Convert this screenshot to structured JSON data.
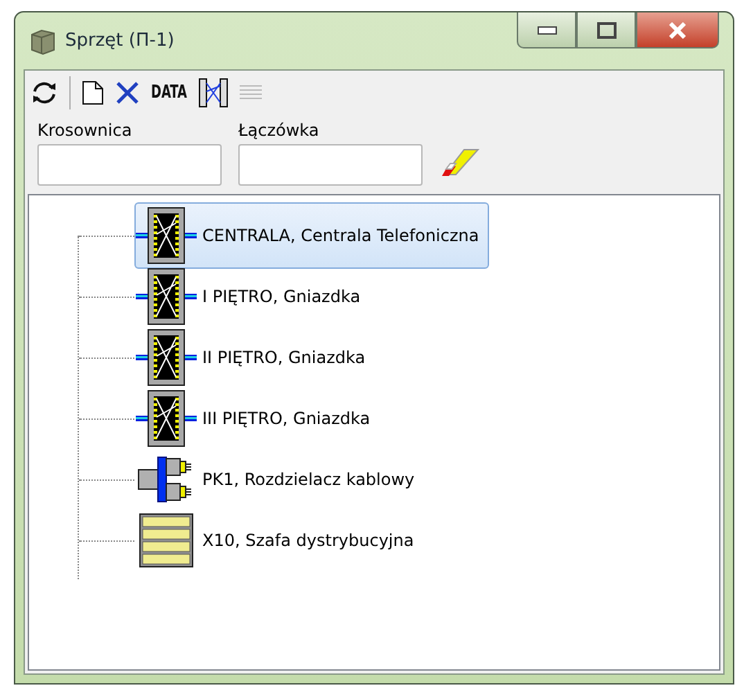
{
  "window": {
    "title": "Sprzęt (П-1)"
  },
  "toolbar": {
    "data_button": "DATA"
  },
  "fields": [
    {
      "label": "Krosownica"
    },
    {
      "label": "Łączówka"
    }
  ],
  "tree": [
    {
      "label": "CENTRALA, Centrala Telefoniczna",
      "kind": "switch",
      "selected": true
    },
    {
      "label": "I PIĘTRO, Gniazdka",
      "kind": "switch",
      "selected": false
    },
    {
      "label": "II PIĘTRO, Gniazdka",
      "kind": "switch",
      "selected": false
    },
    {
      "label": "III PIĘTRO, Gniazdka",
      "kind": "switch",
      "selected": false
    },
    {
      "label": "PK1, Rozdzielacz kablowy",
      "kind": "splitter",
      "selected": false
    },
    {
      "label": "X10, Szafa dystrybucyjna",
      "kind": "cabinet",
      "selected": false
    }
  ]
}
